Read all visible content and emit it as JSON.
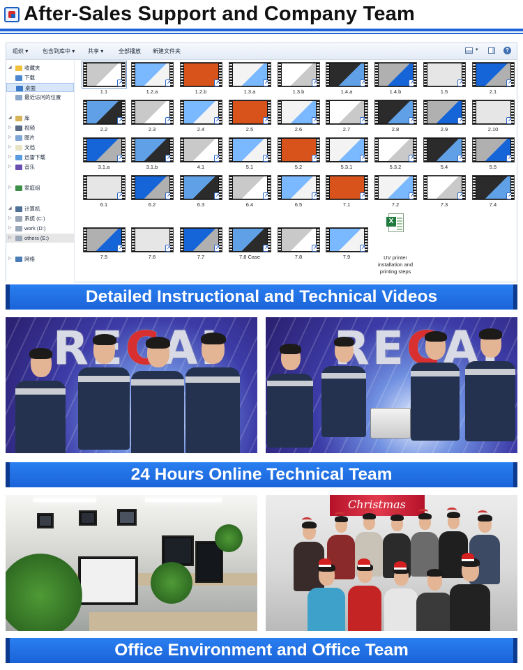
{
  "header": {
    "title": "After-Sales Support and Company Team",
    "logo_icon": "company-logo-icon",
    "rule_color": "#1f63d9"
  },
  "explorer": {
    "toolbar": {
      "organize": "组织 ▾",
      "include_in_library": "包含到库中 ▾",
      "share": "共享 ▾",
      "play_all": "全部播放",
      "new_folder": "新建文件夹"
    },
    "nav": {
      "favorites": "收藏夹",
      "downloads": "下载",
      "desktop": "桌面",
      "recent": "最近访问的位置",
      "library": "库",
      "videos": "视频",
      "pictures": "图片",
      "documents": "文档",
      "thunder": "迅雷下载",
      "music": "音乐",
      "homegroup": "家庭组",
      "computer": "计算机",
      "drive_c": "系统 (C:)",
      "drive_d": "work (D:)",
      "drive_e": "others (E:)",
      "network": "网络"
    },
    "files": [
      {
        "name": "1.1"
      },
      {
        "name": "1.2.a"
      },
      {
        "name": "1.2.b"
      },
      {
        "name": "1.3.a"
      },
      {
        "name": "1.3.b"
      },
      {
        "name": "1.4.a"
      },
      {
        "name": "1.4.b"
      },
      {
        "name": "1.5"
      },
      {
        "name": "2.1"
      },
      {
        "name": "2.2"
      },
      {
        "name": "2.3"
      },
      {
        "name": "2.4"
      },
      {
        "name": "2.5"
      },
      {
        "name": "2.6"
      },
      {
        "name": "2.7"
      },
      {
        "name": "2.8"
      },
      {
        "name": "2.9"
      },
      {
        "name": "2.10"
      },
      {
        "name": "3.1.a"
      },
      {
        "name": "3.1.b"
      },
      {
        "name": "4.1"
      },
      {
        "name": "5.1"
      },
      {
        "name": "5.2"
      },
      {
        "name": "5.3.1"
      },
      {
        "name": "5.3.2"
      },
      {
        "name": "5.4"
      },
      {
        "name": "5.5"
      },
      {
        "name": "6.1"
      },
      {
        "name": "6.2"
      },
      {
        "name": "6.3"
      },
      {
        "name": "6.4"
      },
      {
        "name": "6.5"
      },
      {
        "name": "7.1"
      },
      {
        "name": "7.2"
      },
      {
        "name": "7.3"
      },
      {
        "name": "7.4"
      },
      {
        "name": "7.5"
      },
      {
        "name": "7.6"
      },
      {
        "name": "7.7"
      },
      {
        "name": "7.8  Case"
      },
      {
        "name": "7.8"
      },
      {
        "name": "7.9"
      }
    ],
    "excel_file": "UV printer installation and printing steps"
  },
  "banners": {
    "videos": "Detailed Instructional and Technical Videos",
    "technical_team": "24 Hours Online Technical Team",
    "office": "Office Environment and Office Team"
  },
  "photos": {
    "wall_logo_left": "RECAI",
    "wall_logo_right": "RECAI",
    "christmas_banner": "Christmas"
  }
}
